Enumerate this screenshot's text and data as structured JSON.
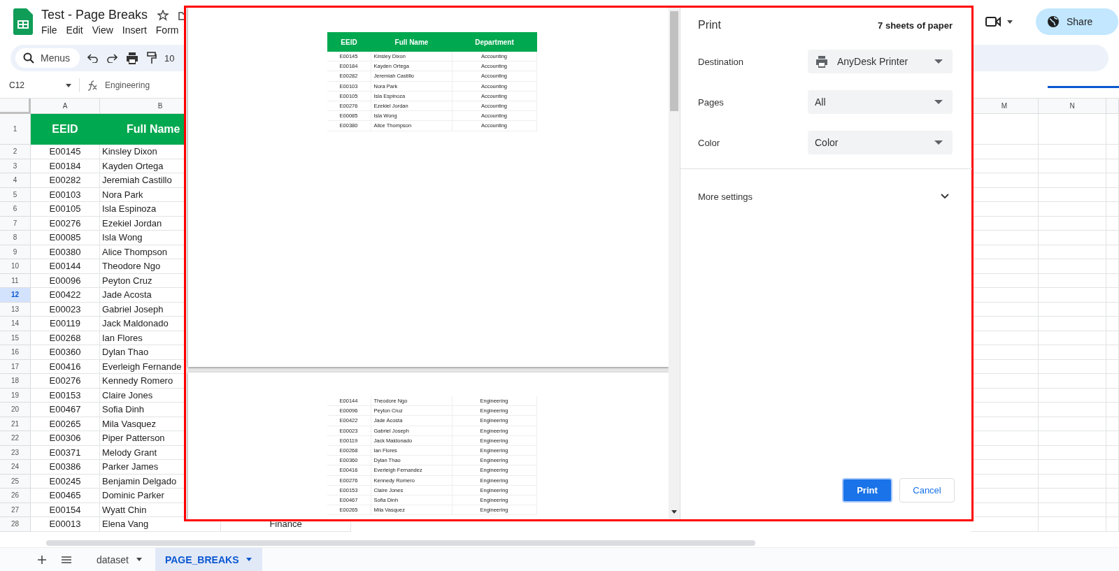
{
  "app": {
    "title": "Test - Page Breaks",
    "menu": [
      "File",
      "Edit",
      "View",
      "Insert",
      "Form"
    ],
    "search_placeholder": "Menus",
    "zoom": "10",
    "share": "Share"
  },
  "formula_bar": {
    "cell": "C12",
    "value": "Engineering"
  },
  "columns": [
    "A",
    "B"
  ],
  "right_columns": [
    "M",
    "N"
  ],
  "header_row": {
    "number": "1",
    "cells": [
      "EEID",
      "Full Name"
    ]
  },
  "rows": [
    {
      "number": "2",
      "selected": false,
      "cells": [
        "E00145",
        "Kinsley Dixon"
      ]
    },
    {
      "number": "3",
      "selected": false,
      "cells": [
        "E00184",
        "Kayden Ortega"
      ]
    },
    {
      "number": "4",
      "selected": false,
      "cells": [
        "E00282",
        "Jeremiah Castillo"
      ]
    },
    {
      "number": "5",
      "selected": false,
      "cells": [
        "E00103",
        "Nora Park"
      ]
    },
    {
      "number": "6",
      "selected": false,
      "cells": [
        "E00105",
        "Isla Espinoza"
      ]
    },
    {
      "number": "7",
      "selected": false,
      "cells": [
        "E00276",
        "Ezekiel Jordan"
      ]
    },
    {
      "number": "8",
      "selected": false,
      "cells": [
        "E00085",
        "Isla Wong"
      ]
    },
    {
      "number": "9",
      "selected": false,
      "cells": [
        "E00380",
        "Alice Thompson"
      ]
    },
    {
      "number": "10",
      "selected": false,
      "cells": [
        "E00144",
        "Theodore Ngo"
      ]
    },
    {
      "number": "11",
      "selected": false,
      "cells": [
        "E00096",
        "Peyton Cruz"
      ]
    },
    {
      "number": "12",
      "selected": true,
      "cells": [
        "E00422",
        "Jade Acosta"
      ]
    },
    {
      "number": "13",
      "selected": false,
      "cells": [
        "E00023",
        "Gabriel Joseph"
      ]
    },
    {
      "number": "14",
      "selected": false,
      "cells": [
        "E00119",
        "Jack Maldonado"
      ]
    },
    {
      "number": "15",
      "selected": false,
      "cells": [
        "E00268",
        "Ian Flores"
      ]
    },
    {
      "number": "16",
      "selected": false,
      "cells": [
        "E00360",
        "Dylan Thao"
      ]
    },
    {
      "number": "17",
      "selected": false,
      "cells": [
        "E00416",
        "Everleigh Fernande"
      ]
    },
    {
      "number": "18",
      "selected": false,
      "cells": [
        "E00276",
        "Kennedy Romero"
      ]
    },
    {
      "number": "19",
      "selected": false,
      "cells": [
        "E00153",
        "Claire Jones"
      ]
    },
    {
      "number": "20",
      "selected": false,
      "cells": [
        "E00467",
        "Sofia Dinh"
      ]
    },
    {
      "number": "21",
      "selected": false,
      "cells": [
        "E00265",
        "Mila Vasquez"
      ]
    },
    {
      "number": "22",
      "selected": false,
      "cells": [
        "E00306",
        "Piper Patterson"
      ]
    },
    {
      "number": "23",
      "selected": false,
      "cells": [
        "E00371",
        "Melody Grant"
      ]
    },
    {
      "number": "24",
      "selected": false,
      "cells": [
        "E00386",
        "Parker James"
      ]
    },
    {
      "number": "25",
      "selected": false,
      "cells": [
        "E00245",
        "Benjamin Delgado"
      ]
    },
    {
      "number": "26",
      "selected": false,
      "cells": [
        "E00465",
        "Dominic Parker"
      ]
    },
    {
      "number": "27",
      "selected": false,
      "cells": [
        "E00154",
        "Wyatt Chin"
      ]
    },
    {
      "number": "28",
      "selected": false,
      "cells": [
        "E00013",
        "Elena Vang",
        "Finance"
      ]
    }
  ],
  "sheet_tabs": [
    {
      "label": "dataset",
      "selected": false
    },
    {
      "label": "PAGE_BREAKS",
      "selected": true
    }
  ],
  "print_dialog": {
    "title": "Print",
    "sheet_count": "7 sheets of paper",
    "settings": [
      {
        "label": "Destination",
        "value": "AnyDesk Printer"
      },
      {
        "label": "Pages",
        "value": "All"
      },
      {
        "label": "Color",
        "value": "Color"
      }
    ],
    "more_settings": "More settings",
    "buttons": [
      {
        "label": "Print",
        "kind": "primary"
      },
      {
        "label": "Cancel",
        "kind": "secondary"
      }
    ],
    "preview_pages": [
      {
        "header": [
          "EEID",
          "Full Name",
          "Department"
        ],
        "rows": [
          [
            "E00145",
            "Kinsley Dixon",
            "Accounting"
          ],
          [
            "E00184",
            "Kayden Ortega",
            "Accounting"
          ],
          [
            "E00282",
            "Jeremiah Castillo",
            "Accounting"
          ],
          [
            "E00103",
            "Nora Park",
            "Accounting"
          ],
          [
            "E00105",
            "Isla Espinoza",
            "Accounting"
          ],
          [
            "E00276",
            "Ezekiel Jordan",
            "Accounting"
          ],
          [
            "E00085",
            "Isla Wong",
            "Accounting"
          ],
          [
            "E00380",
            "Alice Thompson",
            "Accounting"
          ]
        ]
      },
      {
        "rows": [
          [
            "E00144",
            "Theodore Ngo",
            "Engineering"
          ],
          [
            "E00096",
            "Peyton Cruz",
            "Engineering"
          ],
          [
            "E00422",
            "Jade Acosta",
            "Engineering"
          ],
          [
            "E00023",
            "Gabriel Joseph",
            "Engineering"
          ],
          [
            "E00119",
            "Jack Maldonado",
            "Engineering"
          ],
          [
            "E00268",
            "Ian Flores",
            "Engineering"
          ],
          [
            "E00360",
            "Dylan Thao",
            "Engineering"
          ],
          [
            "E00416",
            "Everleigh Fernandez",
            "Engineering"
          ],
          [
            "E00276",
            "Kennedy Romero",
            "Engineering"
          ],
          [
            "E00153",
            "Claire Jones",
            "Engineering"
          ],
          [
            "E00467",
            "Sofia Dinh",
            "Engineering"
          ],
          [
            "E00265",
            "Mila Vasquez",
            "Engineering"
          ]
        ]
      }
    ]
  }
}
